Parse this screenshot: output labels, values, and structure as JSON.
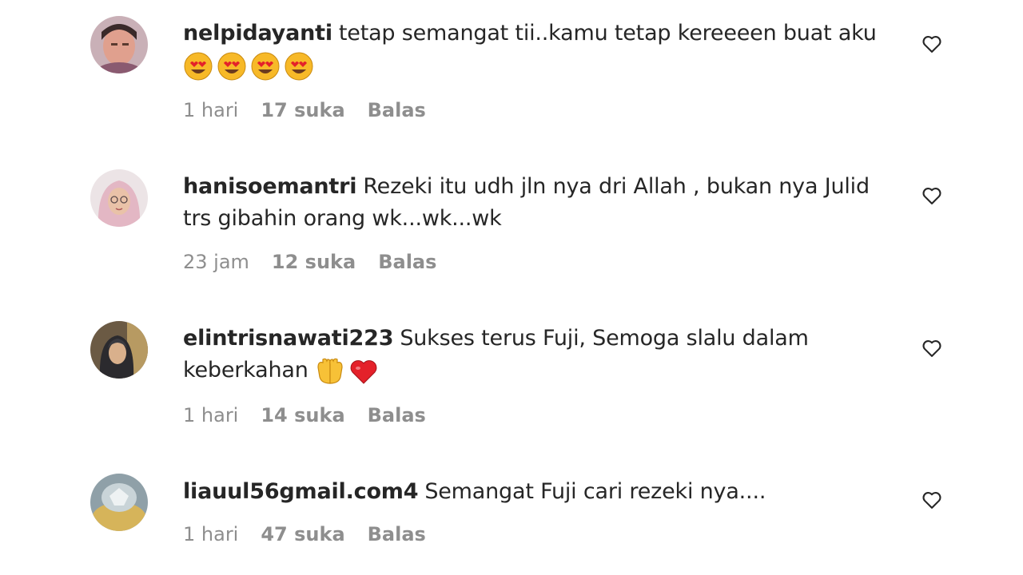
{
  "comments": [
    {
      "username": "nelpidayanti",
      "text": "tetap semangat tii..kamu tetap kereeeen buat aku",
      "emojis": [
        "heart-eyes-emoji",
        "heart-eyes-emoji",
        "heart-eyes-emoji",
        "heart-eyes-emoji"
      ],
      "time": "1 hari",
      "likes": "17 suka",
      "reply": "Balas"
    },
    {
      "username": "hanisoemantri",
      "text": "Rezeki itu udh jln nya dri Allah , bukan nya Julid trs gibahin orang wk...wk...wk",
      "emojis": [],
      "time": "23 jam",
      "likes": "12 suka",
      "reply": "Balas"
    },
    {
      "username": "elintrisnawati223",
      "text": "Sukses terus Fuji, Semoga slalu dalam keberkahan",
      "emojis": [
        "palms-up-emoji",
        "red-heart-emoji"
      ],
      "time": "1 hari",
      "likes": "14 suka",
      "reply": "Balas"
    },
    {
      "username": "liauul56gmail.com4",
      "text": "Semangat Fuji cari rezeki nya....",
      "emojis": [],
      "time": "1 hari",
      "likes": "47 suka",
      "reply": "Balas"
    }
  ],
  "icons": {
    "like": "heart-outline-icon"
  },
  "colors": {
    "text": "#262626",
    "meta": "#8e8e8e",
    "background": "#ffffff"
  }
}
